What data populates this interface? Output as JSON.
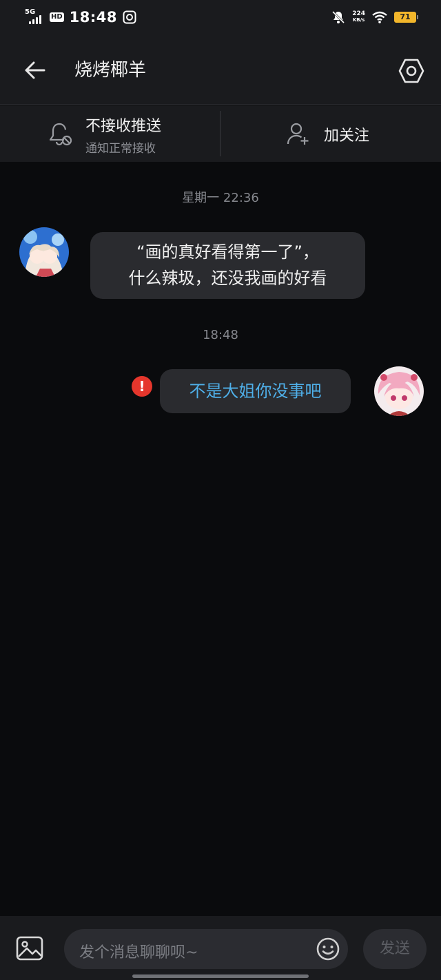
{
  "status_bar": {
    "network": "5G",
    "hd": "HD",
    "time": "18:48",
    "speed_value": "224",
    "speed_unit": "KB/s",
    "battery": "71"
  },
  "header": {
    "title": "烧烤椰羊",
    "back_icon": "back-arrow-icon",
    "settings_icon": "settings-icon"
  },
  "actions": {
    "push_title": "不接收推送",
    "push_sub": "通知正常接收",
    "follow_label": "加关注"
  },
  "messages": [
    {
      "timestamp": "星期一  22:36",
      "direction": "incoming",
      "lines": [
        "“画的真好看得第一了”，",
        "什么辣圾，还没我画的好看"
      ]
    },
    {
      "timestamp": "18:48",
      "direction": "outgoing",
      "text": "不是大姐你没事吧",
      "status": "failed",
      "status_mark": "!"
    }
  ],
  "composer": {
    "placeholder": "发个消息聊聊呗~",
    "send_label": "发送"
  },
  "colors": {
    "background": "#0a0b0d",
    "bar": "#1a1b1e",
    "bubble": "#2a2b2f",
    "outgoing_text": "#4fb0ea",
    "error": "#e5362c",
    "battery": "#f2b62b"
  }
}
